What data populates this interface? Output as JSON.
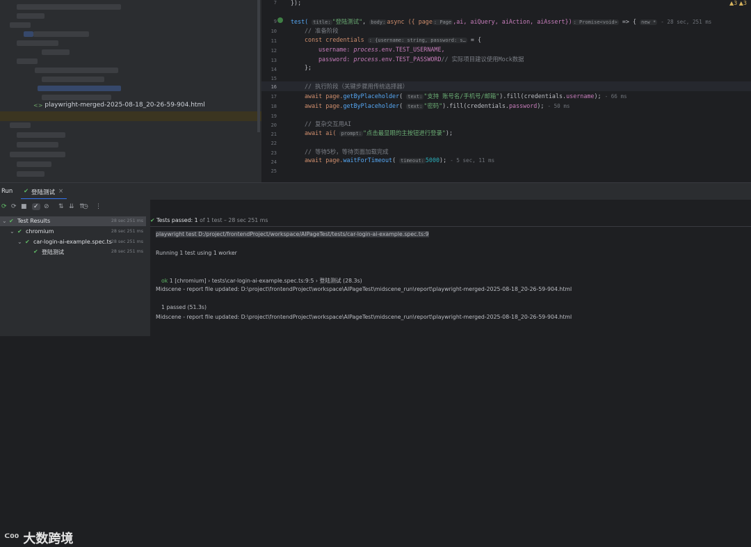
{
  "tree": {
    "file_name": "playwright-merged-2025-08-18_20-26-59-904.html"
  },
  "editor": {
    "warnings": "▲3 ▲3",
    "lines": [
      {
        "n": "7",
        "text": "});"
      },
      {
        "n": "9"
      },
      {
        "n": "10",
        "text": "// 准备阶段"
      },
      {
        "n": "11"
      },
      {
        "n": "12"
      },
      {
        "n": "13"
      },
      {
        "n": "14",
        "text": "};"
      },
      {
        "n": "15"
      },
      {
        "n": "16",
        "text": "// 执行阶段（关键步骤用传统选择器）"
      },
      {
        "n": "17"
      },
      {
        "n": "18"
      },
      {
        "n": "19"
      },
      {
        "n": "20",
        "text": "// 复杂交互用AI"
      },
      {
        "n": "21"
      },
      {
        "n": "22"
      },
      {
        "n": "23",
        "text": "// 等待5秒，等待页面加载完成"
      },
      {
        "n": "24"
      },
      {
        "n": "25"
      }
    ],
    "test_line": {
      "kw": "test(",
      "hint_title": "title:",
      "title": "\"登陆测试\"",
      "hint_body": "body:",
      "body": "async ({ page",
      "hint_page": ": Page",
      "params": ",ai, aiQuery, aiAction, aiAssert})",
      "ret": ": Promise<void>",
      "arrow": "=> {",
      "new": "new *",
      "time": "- 28 sec, 251 ms"
    },
    "cred_line": {
      "decl": "const credentials",
      "hint": ": {username: string, password: s…",
      "eq": "= {"
    },
    "user_line": {
      "prop": "username:",
      "val": "process",
      "rest": ".env.TEST_USERNAME,"
    },
    "pass_line": {
      "prop": "password:",
      "val": "process",
      "rest": ".env.TEST_PASSWORD",
      "cmt": "// 实际项目建议使用Mock数据"
    },
    "l17": {
      "pre": "await page.",
      "fn": "getByPlaceholder",
      "hint": "text:",
      "str": "\"支持 账号名/手机号/邮箱\"",
      "post": ").fill(credentials.",
      "prop": "username",
      "end": ");",
      "time": "- 66 ms"
    },
    "l18": {
      "pre": "await page.",
      "fn": "getByPlaceholder",
      "hint": "text:",
      "str": "\"密码\"",
      "post": ").fill(credentials.",
      "prop": "password",
      "end": ");",
      "time": "- 50 ms"
    },
    "l21": {
      "pre": "await ai(",
      "hint": "prompt:",
      "str": "\"点击最显眼的主按钮进行登录\"",
      "end": ");"
    },
    "l24": {
      "pre": "await page.",
      "fn": "waitForTimeout",
      "hint": "timeout:",
      "num": "5000",
      "end": ");",
      "time": "- 5 sec, 11 ms"
    }
  },
  "toolwindow": {
    "run_label": "Run",
    "tab_label": "登陆测试",
    "tab_close": "×"
  },
  "toolbar": [
    "⟳",
    "⟳",
    "■",
    "✓",
    "⊘",
    "⇅",
    "⇊",
    "⇈",
    "◷",
    "⋮"
  ],
  "test_tree": [
    {
      "name": "Test Results",
      "time": "28 sec 251 ms"
    },
    {
      "name": "chromium",
      "time": "28 sec 251 ms"
    },
    {
      "name": "car-login-ai-example.spec.ts",
      "time": "28 sec 251 ms"
    },
    {
      "name": "登陆测试",
      "time": "28 sec 251 ms"
    }
  ],
  "console": {
    "status_passed": "Tests passed:",
    "status_count": "1",
    "status_rest": "of 1 test – 28 sec 251 ms",
    "cmd": "playwright test D:/project/frontendProject/workspace/AIPageTest/tests/car-login-ai-example.spec.ts:9",
    "running": "Running 1 test using 1 worker",
    "ok_mark": "ok",
    "ok_line": "1 [chromium] › tests\\car-login-ai-example.spec.ts:9:5 › 登陆测试 (28.3s)",
    "report1": "Midscene - report file updated: D:\\project\\frontendProject\\workspace\\AIPageTest\\midscene_run\\report\\playwright-merged-2025-08-18_20-26-59-904.html",
    "passed": "1 passed (51.3s)",
    "report2": "Midscene - report file updated: D:\\project\\frontendProject\\workspace\\AIPageTest\\midscene_run\\report\\playwright-merged-2025-08-18_20-26-59-904.html"
  },
  "watermark": "大数跨境"
}
